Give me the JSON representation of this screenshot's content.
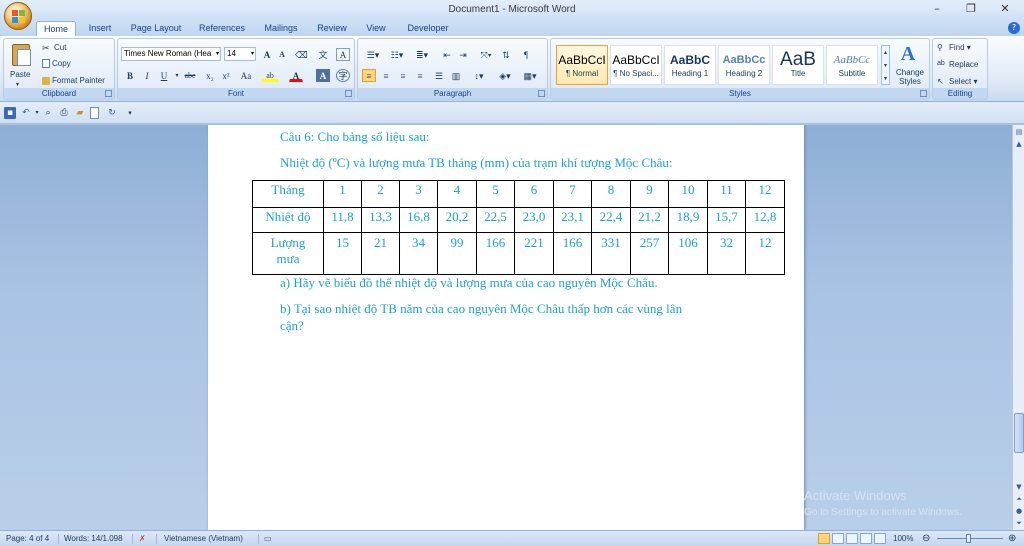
{
  "window": {
    "title": "Document1 - Microsoft Word",
    "minimize": "–",
    "restore": "❐",
    "close": "✕"
  },
  "tabs": [
    "Home",
    "Insert",
    "Page Layout",
    "References",
    "Mailings",
    "Review",
    "View",
    "Developer"
  ],
  "active_tab": "Home",
  "clipboard": {
    "paste": "Paste",
    "cut": "Cut",
    "copy": "Copy",
    "format_painter": "Format Painter",
    "label": "Clipboard"
  },
  "font": {
    "name": "Times New Roman (Hea",
    "size": "14",
    "grow": "A",
    "shrink": "A",
    "bold": "B",
    "italic": "I",
    "underline": "U",
    "strike": "abe",
    "subscript": "x₂",
    "superscript": "x²",
    "change_case": "Aa",
    "highlight": "ab",
    "color": "A",
    "label": "Font"
  },
  "paragraph": {
    "label": "Paragraph"
  },
  "styles": {
    "items": [
      {
        "sample": "AaBbCcI",
        "name": "¶ Normal"
      },
      {
        "sample": "AaBbCcI",
        "name": "¶ No Spaci..."
      },
      {
        "sample": "AaBbC",
        "name": "Heading 1"
      },
      {
        "sample": "AaBbCc",
        "name": "Heading 2"
      },
      {
        "sample": "AaB",
        "name": "Title"
      },
      {
        "sample": "AaBbCc",
        "name": "Subtitle"
      }
    ],
    "change_styles": "Change Styles",
    "label": "Styles"
  },
  "editing": {
    "find": "Find",
    "replace": "Replace",
    "select": "Select",
    "label": "Editing"
  },
  "document": {
    "line1": "Câu 6: Cho bảng số liệu sau:",
    "line2": "Nhiệt độ (ºC) và lượng mưa TB tháng (mm) của trạm khí tượng Mộc Châu:",
    "table": {
      "row_headers": [
        "Tháng",
        "Nhiệt độ",
        "Lượng mưa"
      ],
      "months": [
        "1",
        "2",
        "3",
        "4",
        "5",
        "6",
        "7",
        "8",
        "9",
        "10",
        "11",
        "12"
      ],
      "temperature": [
        "11,8",
        "13,3",
        "16,8",
        "20,2",
        "22,5",
        "23,0",
        "23,1",
        "22,4",
        "21,2",
        "18,9",
        "15,7",
        "12,8"
      ],
      "rainfall": [
        "15",
        "21",
        "34",
        "99",
        "166",
        "221",
        "166",
        "331",
        "257",
        "106",
        "32",
        "12"
      ]
    },
    "question_a": "a) Hãy vẽ biểu đồ thể nhiệt độ và lượng mưa của cao nguyên Mộc Châu.",
    "question_b_1": "b) Tại sao nhiệt độ TB năm của cao nguyên Mộc Châu thấp hơn các vùng lân",
    "question_b_2": "cận?"
  },
  "watermark": {
    "line1": "Activate Windows",
    "line2": "Go to Settings to activate Windows."
  },
  "status": {
    "page": "Page: 4 of 4",
    "words": "Words: 14/1.098",
    "language": "Vietnamese (Vietnam)",
    "zoom": "100%"
  }
}
